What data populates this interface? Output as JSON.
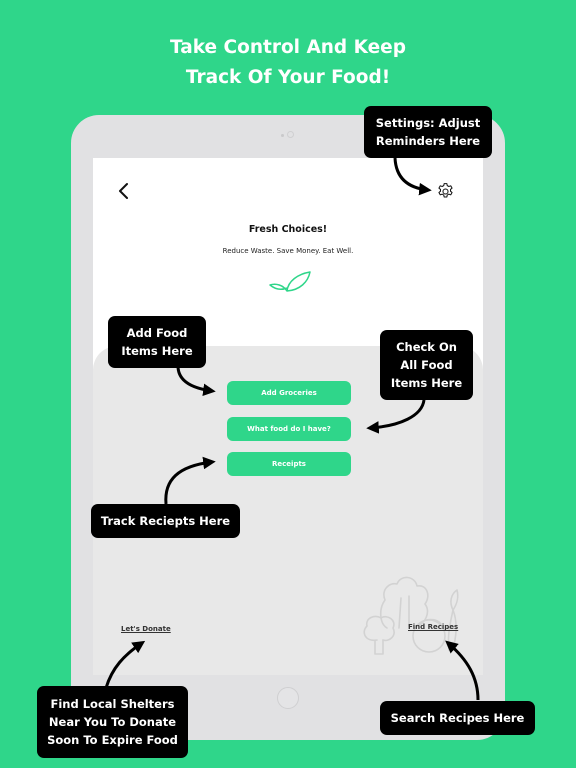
{
  "page": {
    "background_color": "#2fd68a",
    "headline_line1": "Take Control And Keep",
    "headline_line2": "Track Of Your Food!"
  },
  "app": {
    "back_icon": "chevron-left-icon",
    "settings_icon": "gear-icon",
    "title": "Fresh Choices!",
    "tagline": "Reduce Waste. Save Money. Eat Well.",
    "logo_icon": "leaf-icon",
    "accent_color": "#2fd68a",
    "buttons": [
      {
        "label": "Add Groceries"
      },
      {
        "label": "What food do I have?"
      },
      {
        "label": "Receipts"
      }
    ],
    "donate_link": "Let's Donate",
    "recipes_link": "Find Recipes",
    "illustration_icon": "vegetables-icon"
  },
  "callouts": {
    "settings": {
      "line1": "Settings: Adjust",
      "line2": "Reminders Here"
    },
    "add_food": {
      "line1": "Add Food",
      "line2": "Items Here"
    },
    "check_food": {
      "line1": "Check On",
      "line2": "All Food",
      "line3": "Items Here"
    },
    "receipts": {
      "line1": "Track Reciepts Here"
    },
    "donate": {
      "line1": "Find Local Shelters",
      "line2": "Near You To Donate",
      "line3": "Soon To Expire Food"
    },
    "recipes": {
      "line1": "Search Recipes Here"
    }
  }
}
